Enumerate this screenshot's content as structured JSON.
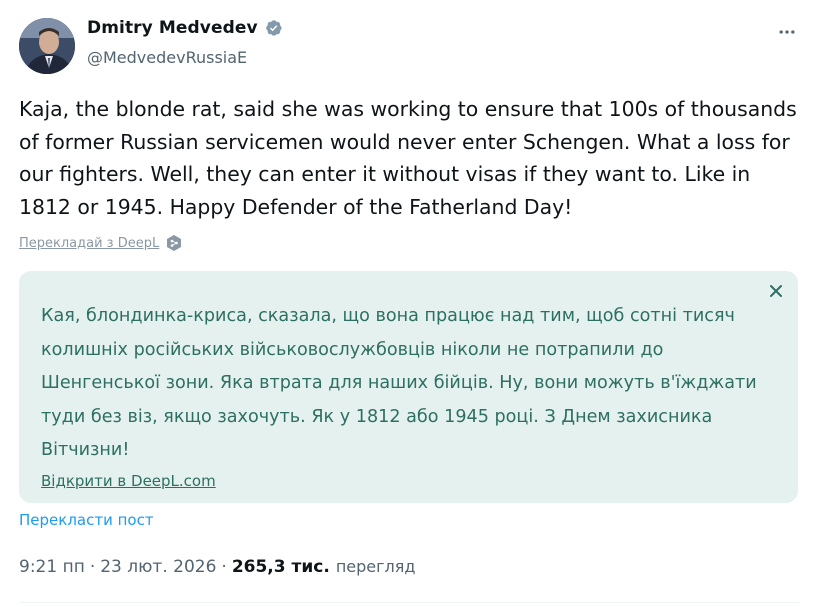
{
  "author": {
    "name": "Dmitry Medvedev",
    "handle": "@MedvedevRussiaE",
    "verified_icon": "verified-badge-icon",
    "verified_color": "#829aab"
  },
  "tweet": {
    "text": "Kaja, the blonde rat, said she was working to ensure that 100s of thousands of former Russian servicemen would never enter Schengen. What a loss for our fighters. Well, they can enter it without visas if they want to. Like in 1812 or 1945. Happy Defender of the Fatherland Day!"
  },
  "deepl": {
    "link_label": "Перекладай з DeepL",
    "translation": "Кая, блондинка-криса, сказала, що вона працює над тим, щоб сотні тисяч колишніх російських військовослужбовців ніколи не потрапили до Шенгенської зони. Яка втрата для наших бійців. Ну, вони можуть в'їжджати туди без віз, якщо захочуть. Як у 1812 або 1945 році. З Днем захисника Вітчизни!",
    "open_label": "Відкрити в DeepL.com",
    "box_color": "#e4f1ef",
    "text_color": "#2e6f63"
  },
  "translate_post_label": "Перекласти пост",
  "meta": {
    "time": "9:21 пп",
    "separator": "·",
    "date": "23 лют. 2026",
    "views_count": "265,3 тис.",
    "views_label": "перегляд"
  },
  "colors": {
    "accent": "#1d9bf0",
    "secondary_text": "#536471"
  }
}
